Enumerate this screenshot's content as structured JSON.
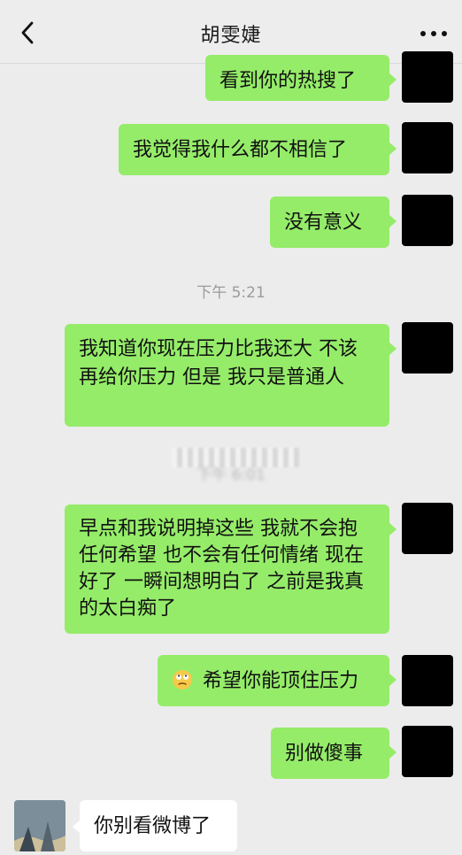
{
  "header": {
    "title": "胡雯婕"
  },
  "messages": [
    {
      "side": "right",
      "text": "看到你的热搜了"
    },
    {
      "side": "right",
      "text": "我觉得我什么都不相信了"
    },
    {
      "side": "right",
      "text": "没有意义"
    },
    {
      "type": "time",
      "text": "下午 5:21"
    },
    {
      "side": "right",
      "text": "我知道你现在压力比我还大 不该再给你压力 但是 我只是普通人"
    },
    {
      "type": "time",
      "text": "下午 6:01",
      "blurred": true
    },
    {
      "side": "right",
      "text": "早点和我说明掉这些 我就不会抱任何希望 也不会有任何情绪 现在好了 一瞬间想明白了 之前是我真的太白痴了"
    },
    {
      "side": "right",
      "text": "希望你能顶住压力",
      "icon": "face-with-rolling-eyes-emoji"
    },
    {
      "side": "right",
      "text": "别做傻事"
    },
    {
      "side": "left",
      "text": "你别看微博了"
    }
  ],
  "icons": {
    "back": "chevron-left-icon",
    "more": "more-icon",
    "emoji": "face-with-rolling-eyes-emoji"
  },
  "colors": {
    "background": "#ececec",
    "bubble_right": "#95ec69",
    "bubble_left": "#ffffff",
    "header_text": "#1a1a1a",
    "timestamp": "#9b9b9b"
  }
}
